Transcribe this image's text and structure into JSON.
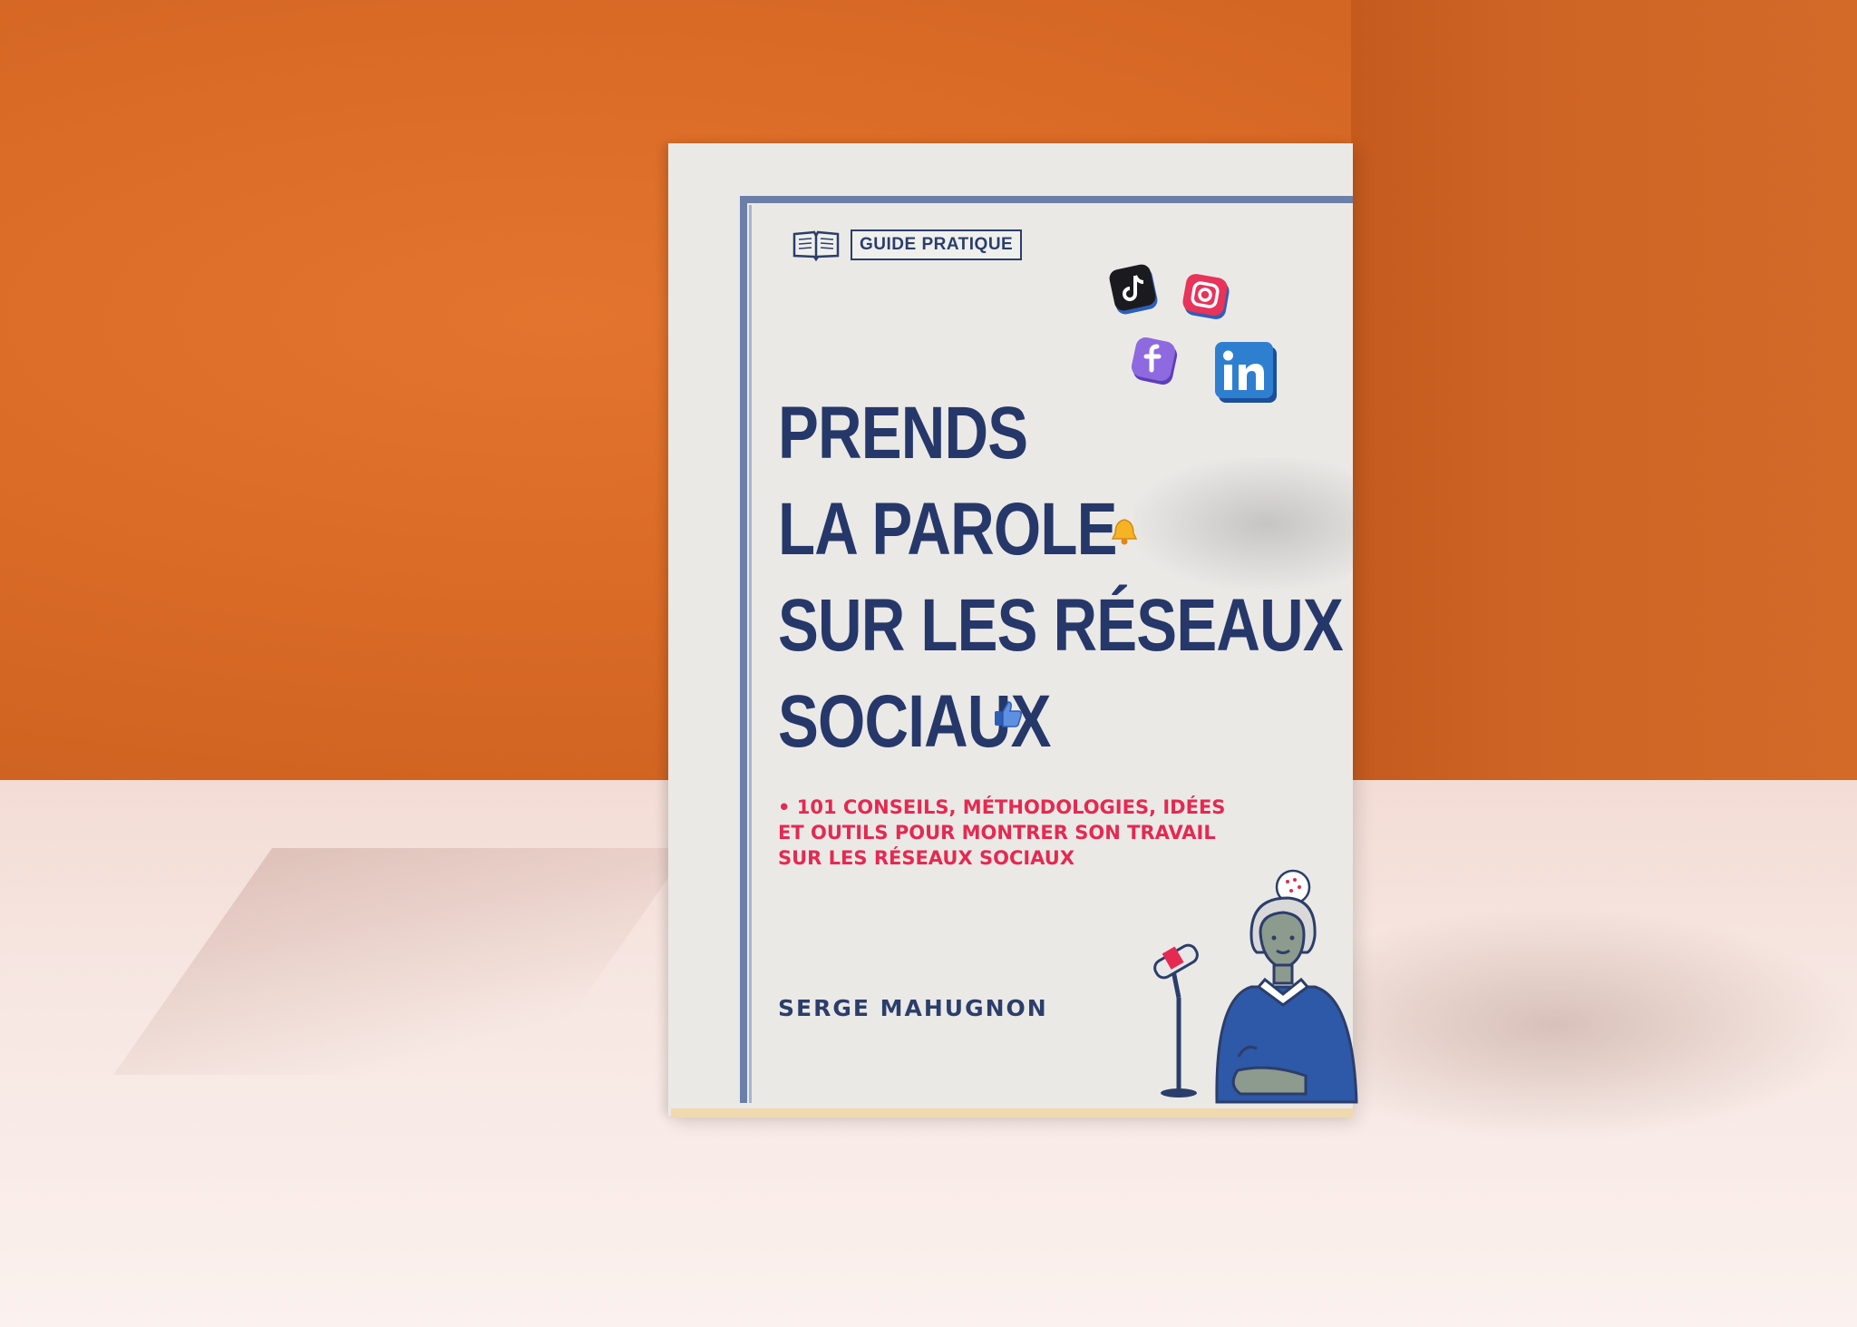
{
  "cover": {
    "badge": "GUIDE PRATIQUE",
    "title_lines": [
      "PRENDS",
      "LA PAROLE",
      "SUR LES RÉSEAUX",
      "SOCIAUX"
    ],
    "subtitle_lines": [
      "• 101 CONSEILS, MÉTHODOLOGIES, IDÉES",
      "ET OUTILS POUR MONTRER SON TRAVAIL",
      "SUR LES RÉSEAUX SOCIAUX"
    ],
    "author": "SERGE MAHUGNON"
  },
  "icons": [
    "open-book-icon",
    "tiktok-icon",
    "instagram-icon",
    "facebook-icon",
    "linkedin-icon",
    "bell-icon",
    "thumbs-up-icon",
    "microphone-icon"
  ],
  "colors": {
    "wall": "#d86a26",
    "cover": "#ebe9e6",
    "title": "#26376a",
    "subtitle": "#e52951",
    "frame": "#6b7fa8"
  }
}
